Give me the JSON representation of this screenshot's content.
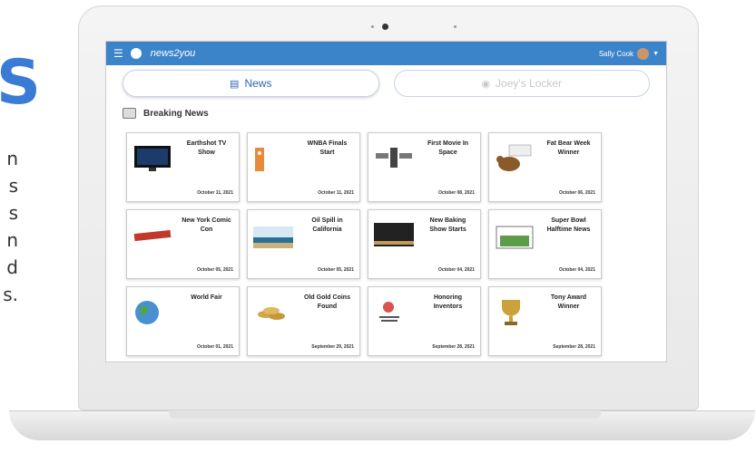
{
  "side": {
    "letter": "S",
    "lines": [
      "n",
      "s",
      "s",
      "n",
      "d",
      "s."
    ]
  },
  "app": {
    "logo": "news2you",
    "user_name": "Sally Cook",
    "menu_icon": "hamburger-icon",
    "globe_icon": "globe-icon",
    "caret_icon": "caret-down-icon"
  },
  "tabs": [
    {
      "label": "News",
      "icon": "newspaper-icon"
    },
    {
      "label": "Joey's Locker",
      "icon": "locker-icon"
    }
  ],
  "section": {
    "title": "Breaking News",
    "icon": "tv-icon"
  },
  "cards": [
    {
      "title": "Earthshot TV Show",
      "date": "October 11, 2021"
    },
    {
      "title": "WNBA Finals Start",
      "date": "October 11, 2021"
    },
    {
      "title": "First Movie In Space",
      "date": "October 08, 2021"
    },
    {
      "title": "Fat Bear Week Winner",
      "date": "October 06, 2021"
    },
    {
      "title": "New York Comic Con",
      "date": "October 05, 2021"
    },
    {
      "title": "Oil Spill in California",
      "date": "October 05, 2021"
    },
    {
      "title": "New Baking Show Starts",
      "date": "October 04, 2021"
    },
    {
      "title": "Super Bowl Halftime News",
      "date": "October 04, 2021"
    },
    {
      "title": "World Fair",
      "date": "October 01, 2021"
    },
    {
      "title": "Old Gold Coins Found",
      "date": "September 29, 2021"
    },
    {
      "title": "Honoring Inventors",
      "date": "September 28, 2021"
    },
    {
      "title": "Tony Award Winner",
      "date": "September 28, 2021"
    }
  ]
}
